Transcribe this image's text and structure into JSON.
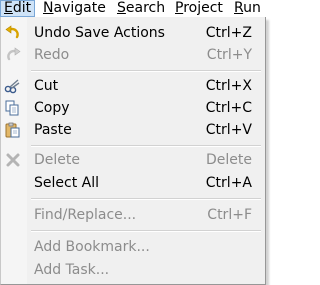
{
  "menubar": {
    "items": [
      {
        "label": "Edit",
        "mnemonic": "E",
        "rest": "dit"
      },
      {
        "label": "Navigate",
        "mnemonic": "N",
        "rest": "avigate"
      },
      {
        "label": "Search",
        "mnemonic": "S",
        "rest": "earch"
      },
      {
        "label": "Project",
        "mnemonic": "P",
        "rest": "roject"
      },
      {
        "label": "Run",
        "mnemonic": "R",
        "rest": "un"
      }
    ]
  },
  "edit_menu": {
    "items": [
      {
        "label": "Undo Save Actions",
        "shortcut": "Ctrl+Z",
        "enabled": true,
        "icon": "undo-icon"
      },
      {
        "label": "Redo",
        "shortcut": "Ctrl+Y",
        "enabled": false,
        "icon": "redo-icon"
      },
      {
        "label": "Cut",
        "shortcut": "Ctrl+X",
        "enabled": true,
        "icon": "cut-icon"
      },
      {
        "label": "Copy",
        "shortcut": "Ctrl+C",
        "enabled": true,
        "icon": "copy-icon"
      },
      {
        "label": "Paste",
        "shortcut": "Ctrl+V",
        "enabled": true,
        "icon": "paste-icon"
      },
      {
        "label": "Delete",
        "shortcut": "Delete",
        "enabled": false,
        "icon": "delete-icon"
      },
      {
        "label": "Select All",
        "shortcut": "Ctrl+A",
        "enabled": true,
        "icon": ""
      },
      {
        "label": "Find/Replace...",
        "shortcut": "Ctrl+F",
        "enabled": false,
        "icon": ""
      },
      {
        "label": "Add Bookmark...",
        "shortcut": "",
        "enabled": false,
        "icon": ""
      },
      {
        "label": "Add Task...",
        "shortcut": "",
        "enabled": false,
        "icon": ""
      }
    ]
  },
  "colors": {
    "active_menu_bg": "#cfe3f7",
    "active_menu_border": "#7aa7d7",
    "disabled_text": "#8c8c8c",
    "undo_icon": "#d9a300"
  }
}
